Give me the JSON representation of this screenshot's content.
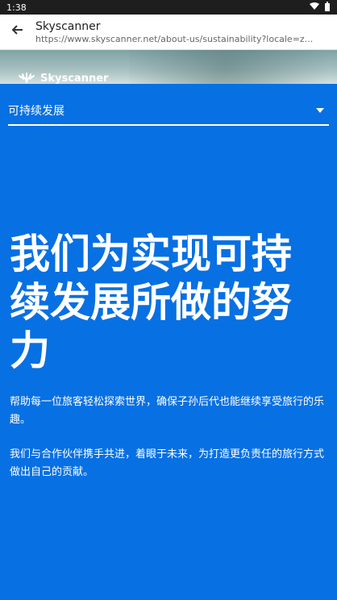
{
  "status_bar": {
    "time": "1:38",
    "icons": [
      "wifi-icon",
      "battery-icon"
    ]
  },
  "browser": {
    "back_icon": "arrow-left-icon",
    "title": "Skyscanner",
    "url": "https://www.skyscanner.net/about-us/sustainability?locale=z..."
  },
  "brand": {
    "name": "Skyscanner",
    "logo_icon": "sunrise-logo-icon"
  },
  "selector": {
    "label": "可持续发展",
    "caret_icon": "chevron-down-icon"
  },
  "main": {
    "headline": "我们为实现可持续发展所做的努力",
    "paragraph1": "帮助每一位旅客轻松探索世界，确保子孙后代也能继续享受旅行的乐趣。",
    "paragraph2": "我们与合作伙伴携手共进，着眼于未来，为打造更负责任的旅行方式做出自己的贡献。"
  },
  "colors": {
    "brand_blue": "#0770e3",
    "text_white": "#ffffff"
  }
}
